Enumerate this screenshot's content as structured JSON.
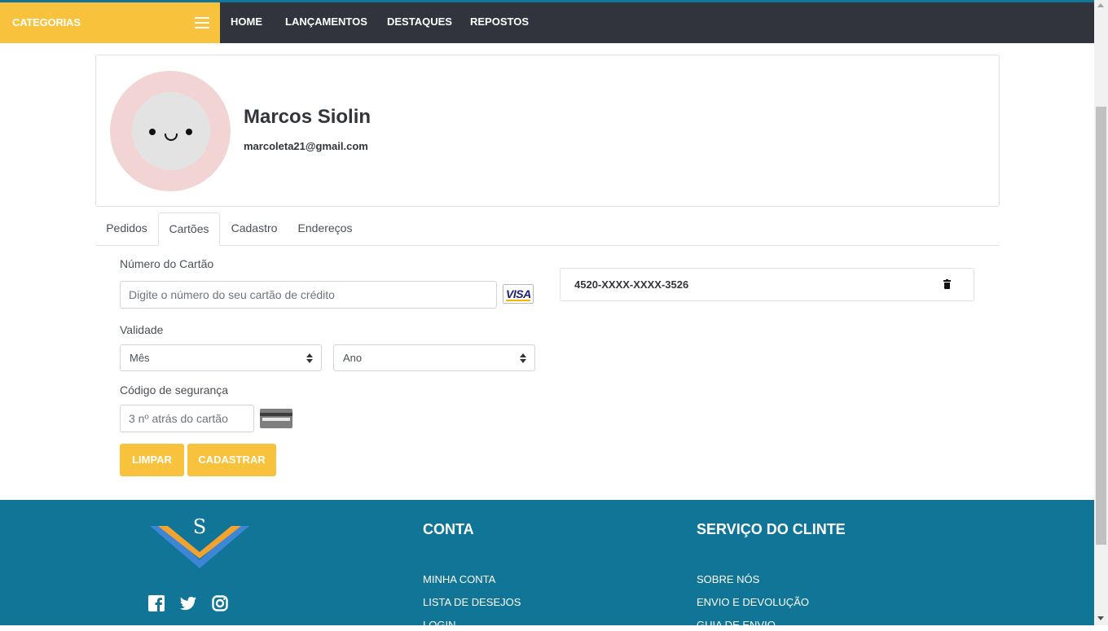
{
  "nav": {
    "categories_label": "CATEGORIAS",
    "links": [
      "HOME",
      "LANÇAMENTOS",
      "DESTAQUES",
      "REPOSTOS"
    ]
  },
  "profile": {
    "name": "Marcos Siolin",
    "email": "marcoleta21@gmail.com"
  },
  "tabs": [
    "Pedidos",
    "Cartões",
    "Cadastro",
    "Endereços"
  ],
  "active_tab": "Cartões",
  "card_form": {
    "number_label": "Número do Cartão",
    "number_placeholder": "Digite o número do seu cartão de crédito",
    "validity_label": "Validade",
    "month_value": "Mês",
    "year_value": "Ano",
    "cvv_label": "Código de segurança",
    "cvv_placeholder": "3 nº atrás do cartão",
    "card_brand": "VISA",
    "clear_label": "LIMPAR",
    "submit_label": "CADASTRAR"
  },
  "saved_cards": [
    {
      "number": "4520-XXXX-XXXX-3526"
    }
  ],
  "footer": {
    "logo_letter": "S",
    "account_heading": "CONTA",
    "account_links": [
      "MINHA CONTA",
      "LISTA DE DESEJOS",
      "LOGIN"
    ],
    "service_heading": "SERVIÇO DO CLINTE",
    "service_links": [
      "SOBRE NÓS",
      "ENVIO E DEVOLUÇÃO",
      "GUIA DE ENVIO"
    ],
    "social_icons": [
      "facebook-icon",
      "twitter-icon",
      "instagram-icon"
    ]
  },
  "colors": {
    "accent": "#f9c23c",
    "navbar": "#31343c",
    "footer": "#107596",
    "avatar_ring": "#f2d4d5"
  }
}
